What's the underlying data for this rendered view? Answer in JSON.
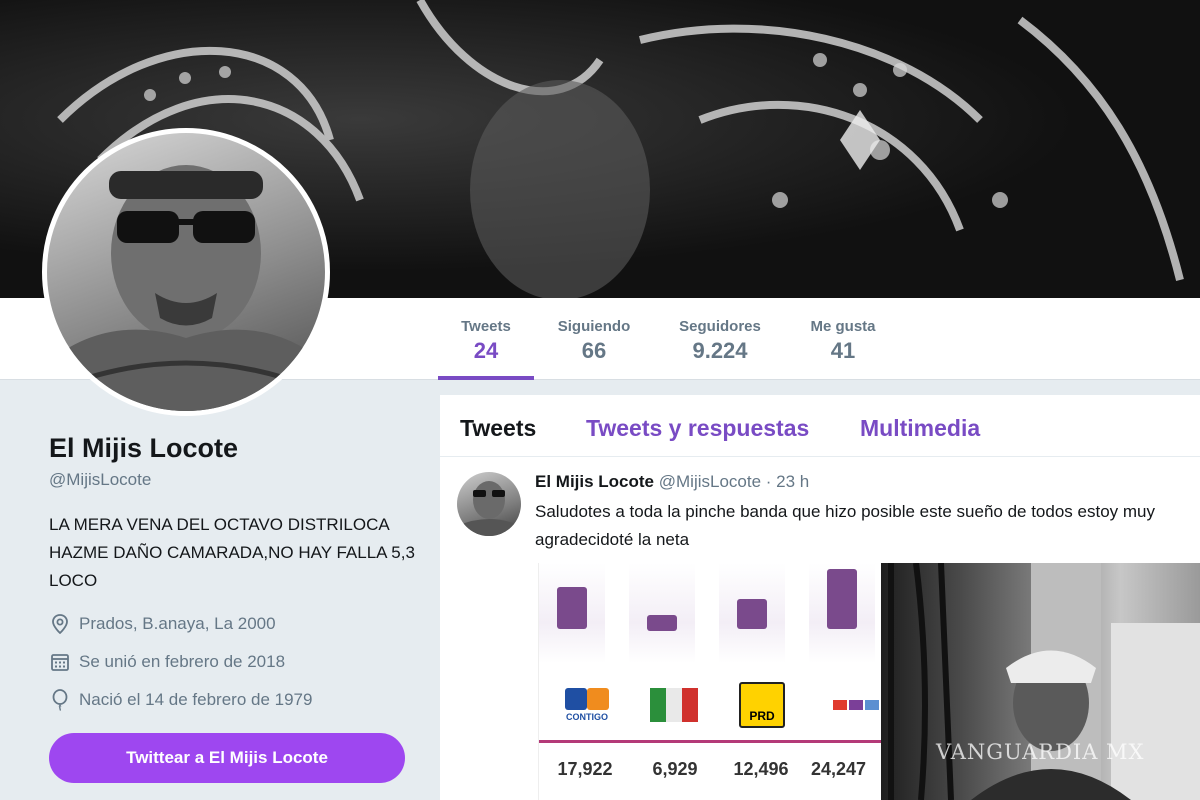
{
  "profile": {
    "name": "El Mijis Locote",
    "handle": "@MijisLocote",
    "bio": "LA MERA VENA DEL OCTAVO DISTRILOCA HAZME DAÑO CAMARADA,NO HAY FALLA 5,3 LOCO",
    "location": "Prados, B.anaya, La 2000",
    "joined": "Se unió en febrero de 2018",
    "born": "Nació el 14 de febrero de 1979",
    "tweet_button": "Twittear a El Mijis Locote"
  },
  "stats": [
    {
      "label": "Tweets",
      "value": "24"
    },
    {
      "label": "Siguiendo",
      "value": "66"
    },
    {
      "label": "Seguidores",
      "value": "9.224"
    },
    {
      "label": "Me gusta",
      "value": "41"
    }
  ],
  "tabs": [
    "Tweets",
    "Tweets y respuestas",
    "Multimedia"
  ],
  "tweet": {
    "name": "El Mijis Locote",
    "meta": "@MijisLocote · 23 h",
    "text": "Saludotes a toda la pinche banda que hizo posible este sueño de todos estoy muy agradecidoté la neta"
  },
  "embedded": {
    "logos": [
      "CONTIGO",
      "",
      "PRD",
      ""
    ],
    "numbers": [
      "17,922",
      "6,929",
      "12,496",
      "24,247"
    ]
  },
  "watermark": "VANGUARDIA MX",
  "colors": {
    "accent": "#794bc4",
    "button": "#9e47f0",
    "bars": "#7a4a8c",
    "separator": "#b43a78"
  }
}
